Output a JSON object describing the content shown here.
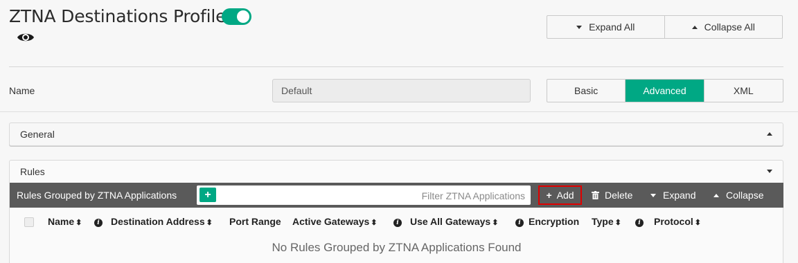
{
  "header": {
    "title": "ZTNA Destinations Profile",
    "enabled": true
  },
  "view_controls": {
    "expand_all": "Expand All",
    "collapse_all": "Collapse All"
  },
  "name_field": {
    "label": "Name",
    "value": "Default"
  },
  "mode_tabs": [
    {
      "label": "Basic",
      "active": false
    },
    {
      "label": "Advanced",
      "active": true
    },
    {
      "label": "XML",
      "active": false
    }
  ],
  "sections": {
    "general": {
      "title": "General"
    },
    "rules": {
      "title": "Rules",
      "toolbar": {
        "title": "Rules Grouped by ZTNA Applications",
        "filter_placeholder": "Filter ZTNA Applications",
        "add": "Add",
        "delete": "Delete",
        "expand": "Expand",
        "collapse": "Collapse"
      },
      "columns": [
        {
          "label": "Name"
        },
        {
          "label": "Destination Address"
        },
        {
          "label": "Port Range"
        },
        {
          "label": "Active Gateways"
        },
        {
          "label": "Use All Gateways"
        },
        {
          "label": "Encryption"
        },
        {
          "label": "Type"
        },
        {
          "label": "Protocol"
        }
      ],
      "empty_message": "No Rules Grouped by ZTNA Applications Found"
    }
  },
  "colors": {
    "accent": "#00a884",
    "toolbar": "#5a5a5a",
    "highlight": "#e00000"
  }
}
